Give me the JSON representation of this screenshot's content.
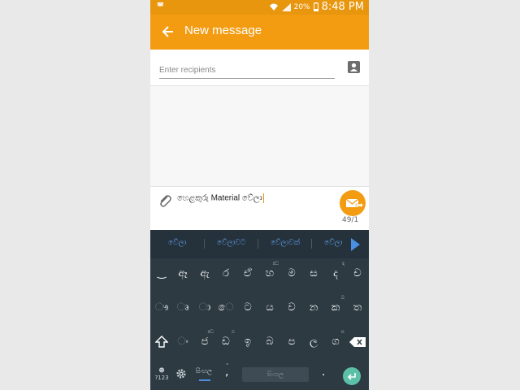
{
  "status_bar": {
    "left_indicator": "◚",
    "battery_percent": "20%",
    "time": "8:48 PM"
  },
  "app_bar": {
    "title": "New message",
    "back_icon": "arrow-left-icon"
  },
  "recipients": {
    "placeholder": "Enter recipients",
    "contact_icon": "contact-card-icon"
  },
  "compose": {
    "message_text": "හෙළකුරු Material වේලා",
    "counter": "49/1",
    "attach_icon": "paperclip-icon",
    "send_icon": "send-envelope-icon"
  },
  "suggestions": [
    "වේලා",
    "වේලාවට",
    "වේලාවක්",
    "වේලා"
  ],
  "keyboard": {
    "row1": [
      "‿",
      "ඈ",
      "ඇ",
      "ර",
      "ඒ",
      "හ",
      "ම",
      "ස",
      "ද",
      "ච"
    ],
    "row1_hints": [
      "",
      "",
      "",
      "",
      "",
      "ඣ",
      "",
      "",
      "ඳ",
      ""
    ],
    "row2": [
      "ෟ",
      "ෘ",
      "ා",
      "ෙ",
      "ට",
      "ය",
      "ව",
      "න",
      "ක",
      "ත"
    ],
    "row2_hints": [
      "",
      "",
      "",
      "",
      "",
      "",
      "",
      "",
      "ඛ",
      ""
    ],
    "row3": [
      "ං",
      "ජ",
      "ඩ",
      "ඉ",
      "බ",
      "ප",
      "ල",
      "ග"
    ],
    "row3_hints": [
      "",
      "ඣ",
      "ඪ",
      "",
      "",
      "",
      "",
      "ඝ"
    ],
    "symbols_label": "?123",
    "symbols_top": "☻",
    "language_label": "සිංහල",
    "comma": ",",
    "comma_hint": "\"",
    "space_label": "සිංහල",
    "period": ".",
    "colors": {
      "accent": "#f39c12",
      "keyboard_bg": "#2d3a42",
      "suggestion_text": "#5ea2ef",
      "enter_bg": "#5cbfa7"
    }
  }
}
